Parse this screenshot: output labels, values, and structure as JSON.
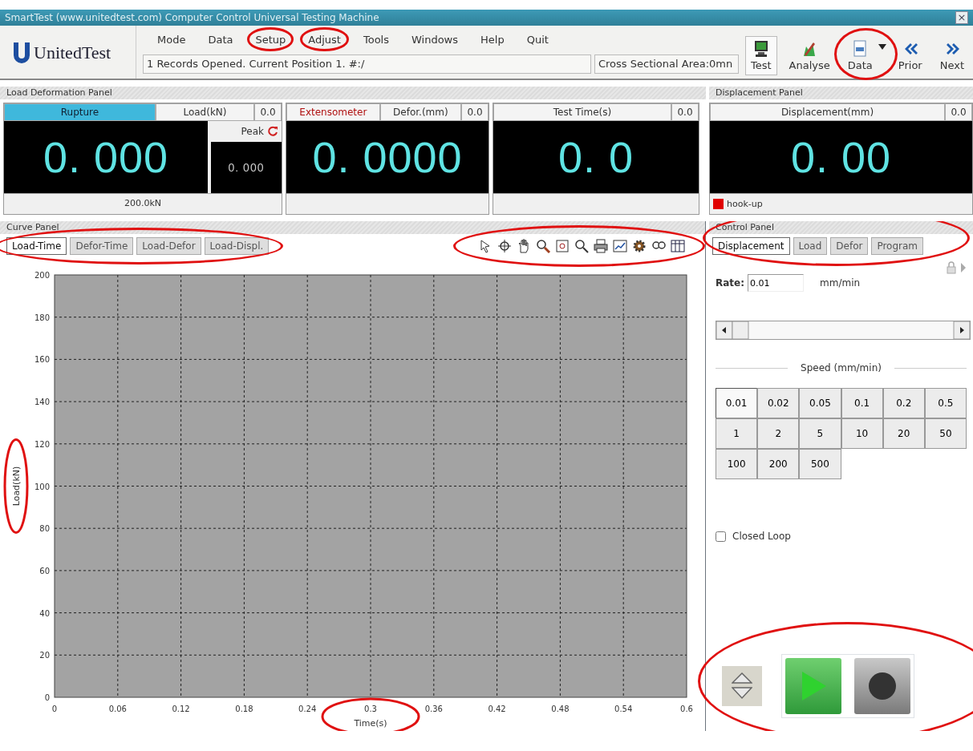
{
  "window": {
    "title": "SmartTest (www.unitedtest.com) Computer Control Universal Testing Machine",
    "close": "×"
  },
  "logo": {
    "text": "UnitedTest"
  },
  "menu": [
    {
      "label": "Mode",
      "highlighted": false
    },
    {
      "label": "Data",
      "highlighted": false
    },
    {
      "label": "Setup",
      "highlighted": true
    },
    {
      "label": "Adjust",
      "highlighted": true
    },
    {
      "label": "Tools",
      "highlighted": false
    },
    {
      "label": "Windows",
      "highlighted": false
    },
    {
      "label": "Help",
      "highlighted": false
    },
    {
      "label": "Quit",
      "highlighted": false
    }
  ],
  "status": {
    "records": "1 Records Opened. Current Position 1. #:/",
    "area": "Cross Sectional Area:0mn"
  },
  "toolbar": [
    {
      "kind": "test",
      "label": "Test",
      "selected": true,
      "highlighted": false
    },
    {
      "kind": "analyse",
      "label": "Analyse",
      "selected": false,
      "highlighted": false
    },
    {
      "kind": "data",
      "label": "Data",
      "selected": false,
      "highlighted": true
    },
    {
      "kind": "prior",
      "label": "Prior",
      "selected": false,
      "highlighted": false
    },
    {
      "kind": "next",
      "label": "Next",
      "selected": false,
      "highlighted": false
    }
  ],
  "load_deformation_panel": {
    "title": "Load Deformation Panel",
    "displays": [
      {
        "kind": "load",
        "tabs": [
          {
            "label": "Rupture",
            "selected": true
          },
          {
            "label": "Load(kN)",
            "selected": false
          }
        ],
        "small": "0.0",
        "value": "0. 000",
        "peak_label": "Peak",
        "peak_value": "0. 000",
        "footer": "200.0kN"
      },
      {
        "kind": "defor",
        "tabs": [
          {
            "label": "Extensometer",
            "selected": false
          },
          {
            "label": "Defor.(mm)",
            "selected": false
          }
        ],
        "small": "0.0",
        "value": "0. 0000"
      },
      {
        "kind": "time",
        "tabs": [
          {
            "label": "Test Time(s)",
            "selected": false
          }
        ],
        "small": "0.0",
        "value": "0. 0"
      }
    ]
  },
  "displacement_panel": {
    "title": "Displacement Panel",
    "tab": "Displacement(mm)",
    "small": "0.0",
    "value": "0. 00",
    "indicator": {
      "label": "hook-up",
      "color": "#e00000"
    }
  },
  "curve_panel": {
    "title": "Curve Panel",
    "tabs_highlighted": true,
    "toolbar_highlighted": true,
    "axis_labels_highlighted": true,
    "tabs": [
      {
        "label": "Load-Time",
        "selected": true
      },
      {
        "label": "Defor-Time",
        "selected": false
      },
      {
        "label": "Load-Defor",
        "selected": false
      },
      {
        "label": "Load-Displ.",
        "selected": false
      }
    ],
    "chart_data": {
      "type": "line",
      "grid": true,
      "xlabel": "Time(s)",
      "ylabel": "Load(kN)",
      "xlim": [
        0,
        0.6
      ],
      "ylim": [
        0,
        200
      ],
      "xticks": [
        0,
        0.06,
        0.12,
        0.18,
        0.24,
        0.3,
        0.36,
        0.42,
        0.48,
        0.54,
        0.6
      ],
      "yticks": [
        0,
        20,
        40,
        60,
        80,
        100,
        120,
        140,
        160,
        180,
        200
      ]
    }
  },
  "control_panel": {
    "title": "Control Panel",
    "tabs_highlighted": true,
    "controls_highlighted": true,
    "tabs": [
      {
        "label": "Displacement",
        "selected": true
      },
      {
        "label": "Load",
        "selected": false
      },
      {
        "label": "Defor",
        "selected": false
      },
      {
        "label": "Program",
        "selected": false
      }
    ],
    "rate": {
      "label": "Rate:",
      "value": "0.01",
      "unit": "mm/min"
    },
    "speed_label": "Speed (mm/min)",
    "speeds": [
      {
        "label": "0.01",
        "selected": true
      },
      {
        "label": "0.02",
        "selected": false
      },
      {
        "label": "0.05",
        "selected": false
      },
      {
        "label": "0.1",
        "selected": false
      },
      {
        "label": "0.2",
        "selected": false
      },
      {
        "label": "0.5",
        "selected": false
      },
      {
        "label": "1",
        "selected": false
      },
      {
        "label": "2",
        "selected": false
      },
      {
        "label": "5",
        "selected": false
      },
      {
        "label": "10",
        "selected": false
      },
      {
        "label": "20",
        "selected": false
      },
      {
        "label": "50",
        "selected": false
      },
      {
        "label": "100",
        "selected": false
      },
      {
        "label": "200",
        "selected": false
      },
      {
        "label": "500",
        "selected": false
      }
    ],
    "closed_loop": {
      "label": "Closed Loop",
      "checked": false
    }
  }
}
